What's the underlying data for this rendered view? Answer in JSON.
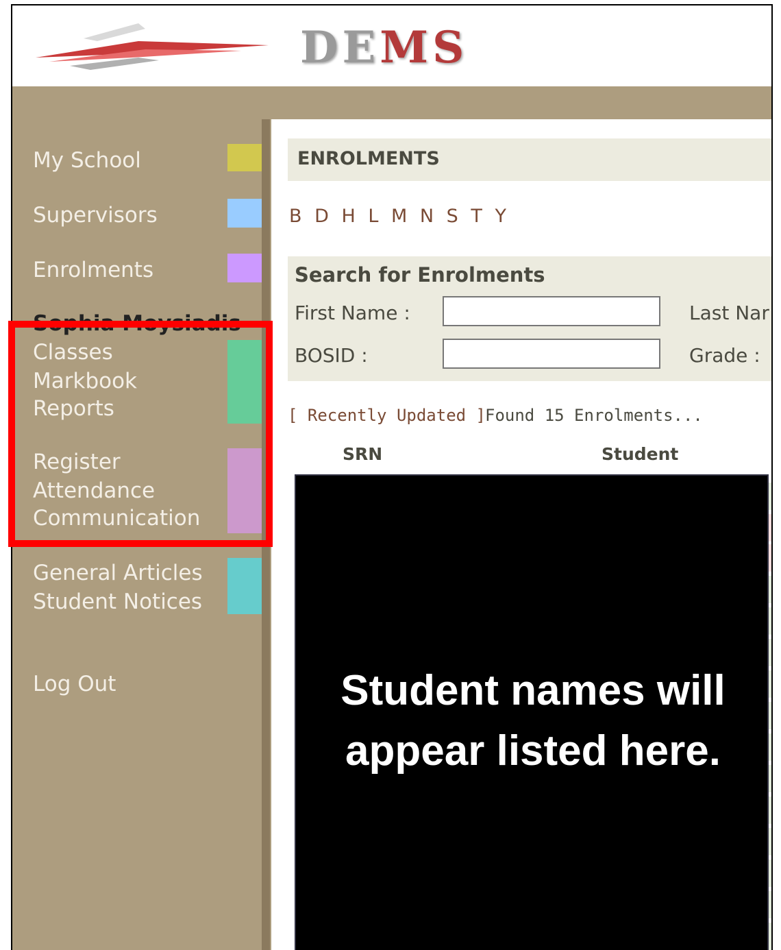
{
  "header": {
    "logo_text_part1": "D",
    "logo_text_part2": "E",
    "logo_text_part3": "MS"
  },
  "sidebar": {
    "items": [
      {
        "label": "My School",
        "color": "#d2c84f"
      },
      {
        "label": "Supervisors",
        "color": "#99ccff"
      },
      {
        "label": "Enrolments",
        "color": "#cc99ff"
      }
    ],
    "user_name": "Sophia Moysiadis",
    "group_teaching": {
      "items": [
        "Classes",
        "Markbook",
        "Reports"
      ],
      "color": "#66cc99"
    },
    "group_admin": {
      "items": [
        "Register",
        "Attendance",
        "Communication"
      ],
      "color": "#cc99cc"
    },
    "group_articles": {
      "items": [
        "General Articles",
        "Student Notices"
      ],
      "color": "#66cccc"
    },
    "logout_label": "Log Out"
  },
  "highlight_color": "#ff0000",
  "main": {
    "section_title": "ENROLMENTS",
    "alpha_index": "B D H L M N S T Y",
    "search": {
      "heading": "Search for Enrolments",
      "first_name_label": "First Name :",
      "first_name_value": "",
      "last_name_label": "Last Nar",
      "bosid_label": "BOSID :",
      "bosid_value": "",
      "grade_label": "Grade :"
    },
    "recent_link": "[ Recently Updated ]",
    "found_text": "Found 15 Enrolments...",
    "columns": [
      "SRN",
      "Student"
    ],
    "redaction_line1": "Student names will",
    "redaction_line2": "appear listed here."
  }
}
